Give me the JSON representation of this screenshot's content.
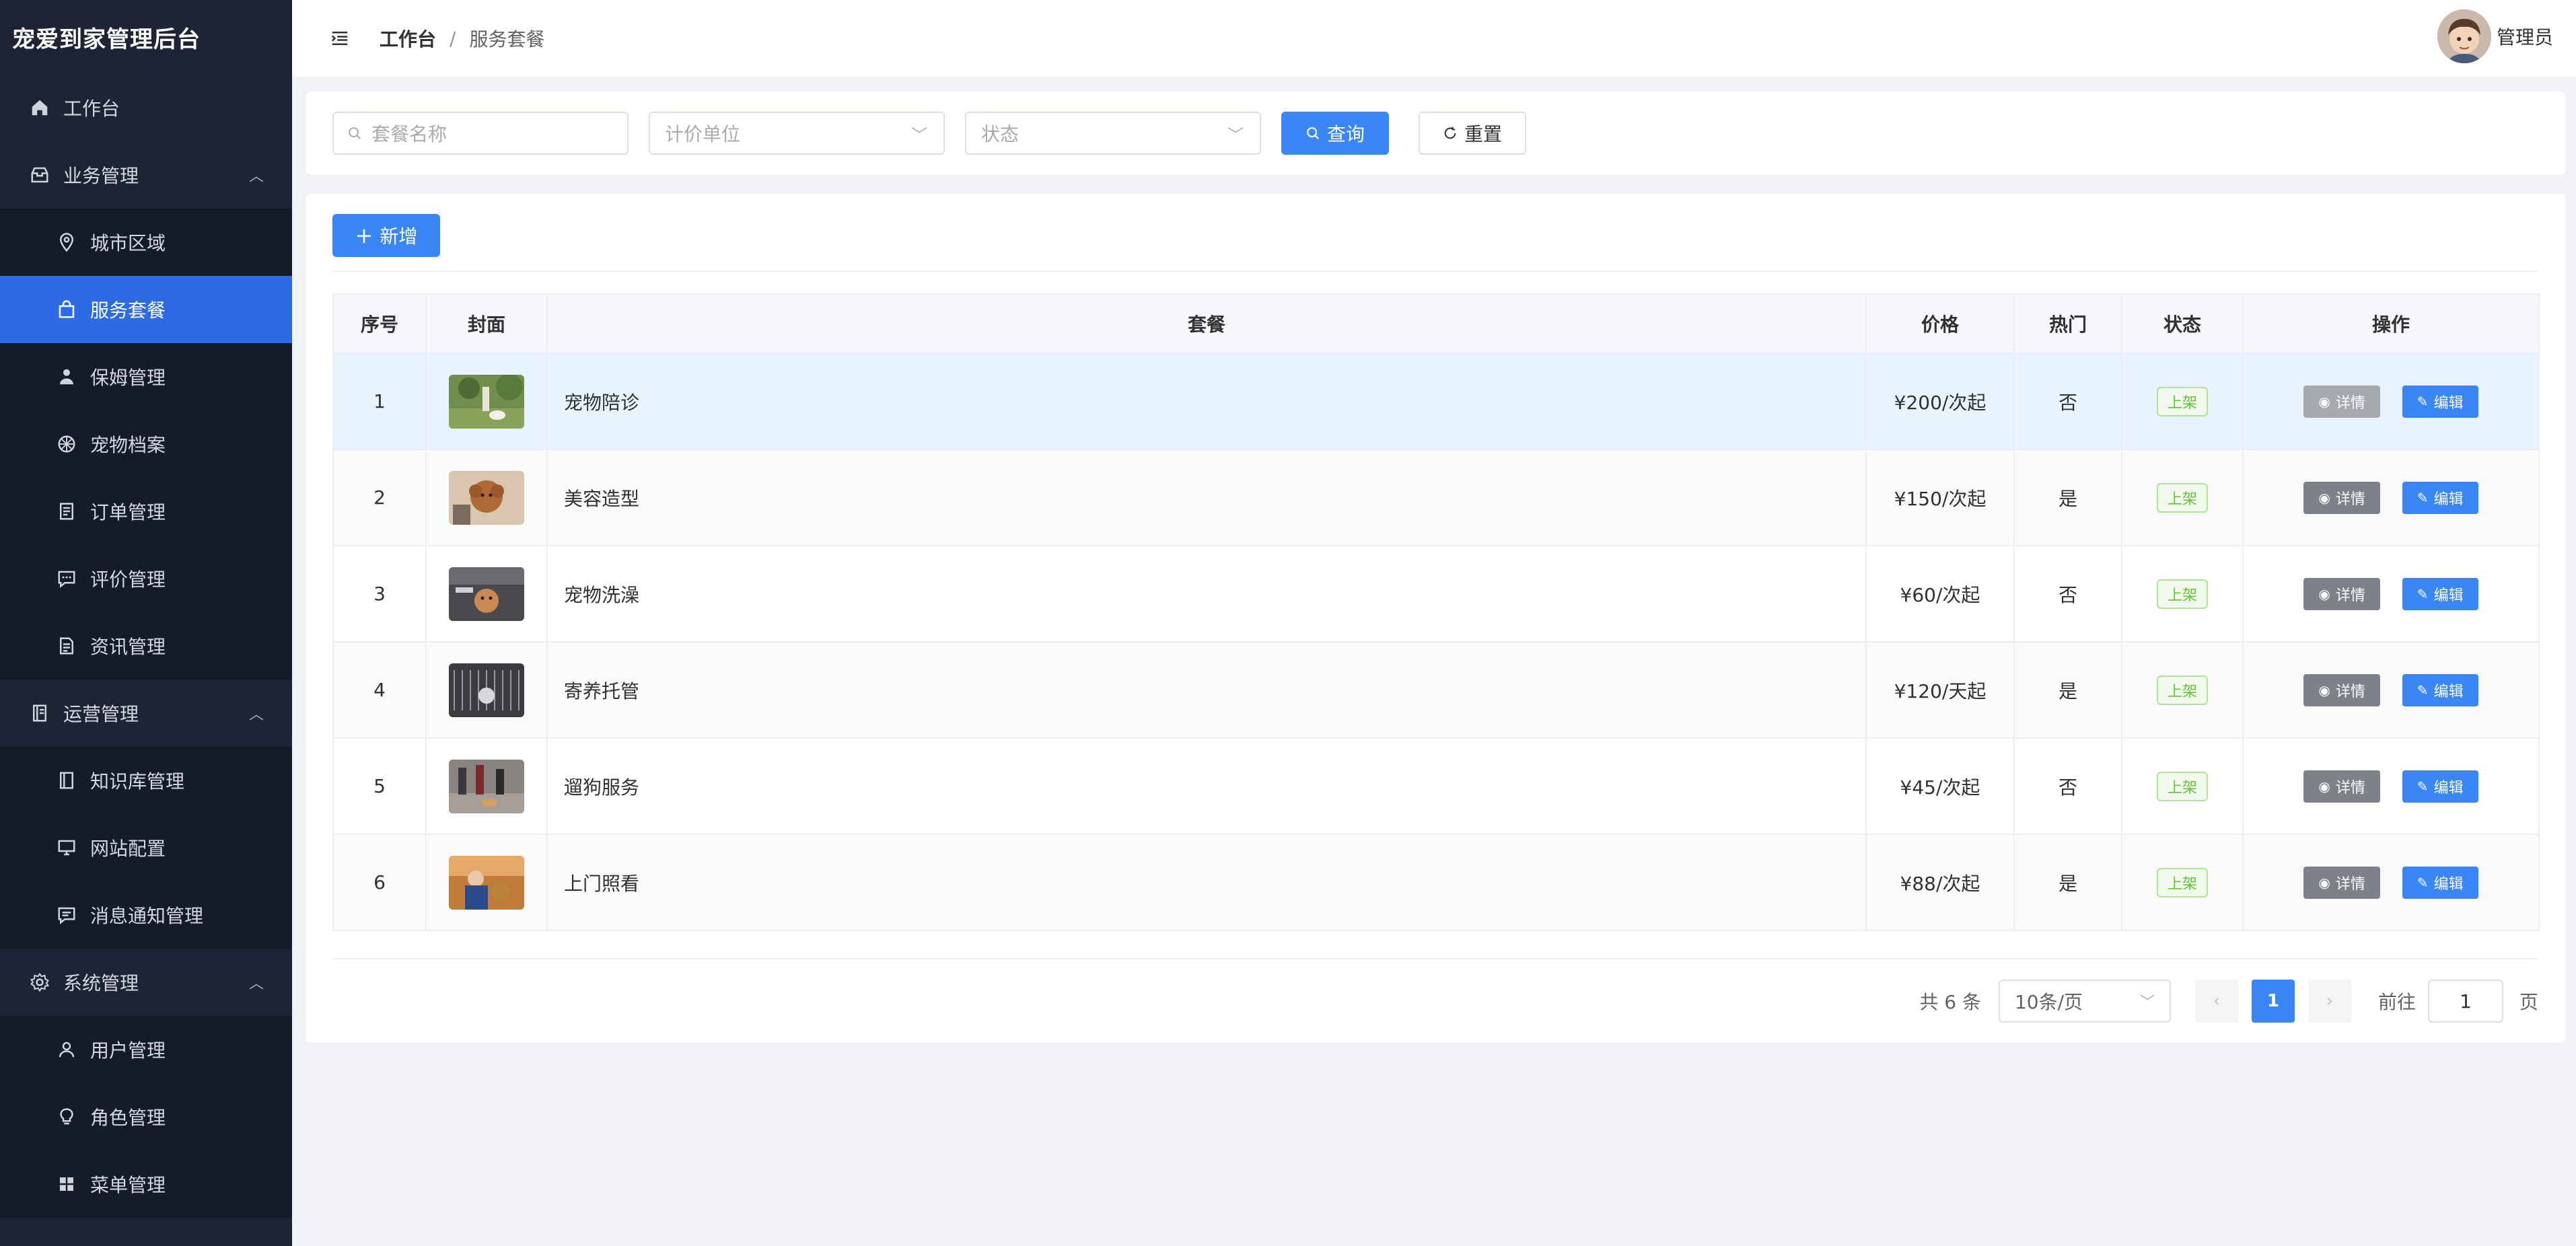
{
  "app": {
    "title": "宠爱到家管理后台"
  },
  "sidebar": {
    "items": [
      {
        "label": "工作台",
        "icon": "home-icon",
        "level": "top"
      },
      {
        "label": "业务管理",
        "icon": "box-icon",
        "level": "top",
        "expanded": true
      },
      {
        "label": "城市区域",
        "icon": "location-icon",
        "level": "sub"
      },
      {
        "label": "服务套餐",
        "icon": "bag-icon",
        "level": "sub",
        "active": true
      },
      {
        "label": "保姆管理",
        "icon": "person-icon",
        "level": "sub"
      },
      {
        "label": "宠物档案",
        "icon": "ball-icon",
        "level": "sub"
      },
      {
        "label": "订单管理",
        "icon": "document-icon",
        "level": "sub"
      },
      {
        "label": "评价管理",
        "icon": "chat-icon",
        "level": "sub"
      },
      {
        "label": "资讯管理",
        "icon": "document-icon",
        "level": "sub"
      },
      {
        "label": "运营管理",
        "icon": "notebook-icon",
        "level": "top",
        "expanded": true
      },
      {
        "label": "知识库管理",
        "icon": "book-icon",
        "level": "sub"
      },
      {
        "label": "网站配置",
        "icon": "monitor-icon",
        "level": "sub"
      },
      {
        "label": "消息通知管理",
        "icon": "message-icon",
        "level": "sub"
      },
      {
        "label": "系统管理",
        "icon": "gear-icon",
        "level": "top",
        "expanded": true
      },
      {
        "label": "用户管理",
        "icon": "user-icon",
        "level": "sub"
      },
      {
        "label": "角色管理",
        "icon": "bulb-icon",
        "level": "sub"
      },
      {
        "label": "菜单管理",
        "icon": "grid-icon",
        "level": "sub"
      }
    ]
  },
  "header": {
    "breadcrumb_home": "工作台",
    "breadcrumb_sep": "/",
    "breadcrumb_current": "服务套餐",
    "user_name": "管理员"
  },
  "search": {
    "name_placeholder": "套餐名称",
    "unit_placeholder": "计价单位",
    "status_placeholder": "状态",
    "query_label": "查询",
    "reset_label": "重置"
  },
  "toolbar": {
    "add_label": "新增"
  },
  "table": {
    "headers": [
      "序号",
      "封面",
      "套餐",
      "价格",
      "热门",
      "状态",
      "操作"
    ],
    "rows": [
      {
        "no": "1",
        "name": "宠物陪诊",
        "price": "¥200/次起",
        "hot": "否",
        "status": "上架"
      },
      {
        "no": "2",
        "name": "美容造型",
        "price": "¥150/次起",
        "hot": "是",
        "status": "上架"
      },
      {
        "no": "3",
        "name": "宠物洗澡",
        "price": "¥60/次起",
        "hot": "否",
        "status": "上架"
      },
      {
        "no": "4",
        "name": "寄养托管",
        "price": "¥120/天起",
        "hot": "是",
        "status": "上架"
      },
      {
        "no": "5",
        "name": "遛狗服务",
        "price": "¥45/次起",
        "hot": "否",
        "status": "上架"
      },
      {
        "no": "6",
        "name": "上门照看",
        "price": "¥88/次起",
        "hot": "是",
        "status": "上架"
      }
    ],
    "detail_label": "详情",
    "edit_label": "编辑"
  },
  "pagination": {
    "total_text": "共 6 条",
    "page_size": "10条/页",
    "current_page": "1",
    "goto_label": "前往",
    "goto_value": "1",
    "page_suffix": "页"
  },
  "colors": {
    "primary": "#3a86f4",
    "sidebar_bg": "#1e2434",
    "active_menu": "#2d6ae3",
    "tag_green": "#67c23a"
  }
}
